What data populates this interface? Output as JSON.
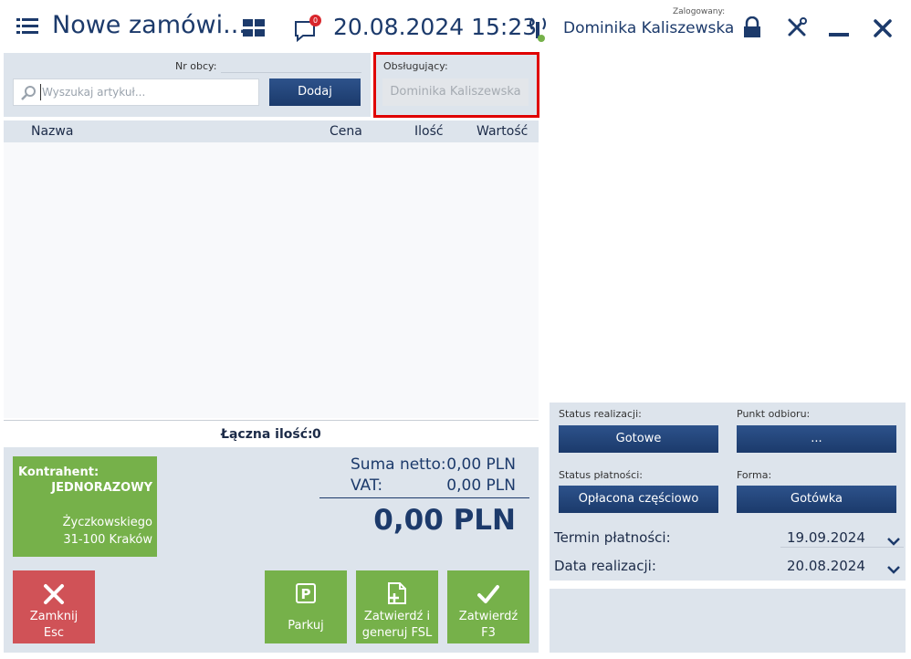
{
  "header": {
    "title": "Nowe zamówi...",
    "datetime": "20.08.2024 15:23",
    "notifications_count": "0",
    "logged_label": "Zalogowany:",
    "user": "Dominika Kaliszewska"
  },
  "top": {
    "foreign_no_label": "Nr obcy:",
    "search_placeholder": "Wyszukaj artykuł...",
    "add_label": "Dodaj",
    "handler_label": "Obsługujący:",
    "handler_value": "Dominika Kaliszewska"
  },
  "table": {
    "columns": [
      "Nazwa",
      "Cena",
      "Ilość",
      "Wartość"
    ],
    "total_qty_label": "Łączna ilość:",
    "total_qty_value": "0"
  },
  "customer": {
    "label": "Kontrahent:",
    "name": "JEDNORAZOWY",
    "street": "Życzkowskiego",
    "city": "31-100 Kraków"
  },
  "totals": {
    "net_label": "Suma netto:",
    "net_value": "0,00 PLN",
    "vat_label": "VAT:",
    "vat_value": "0,00 PLN",
    "gross": "0,00 PLN"
  },
  "actions": {
    "close_label": "Zamknij",
    "close_key": "Esc",
    "park_label": "Parkuj",
    "confirm_fsl_line1": "Zatwierdź i",
    "confirm_fsl_line2": "generuj FSL",
    "confirm_line1": "Zatwierdź",
    "confirm_key": "F3"
  },
  "order": {
    "status_label": "Status realizacji:",
    "status_value": "Gotowe",
    "pickup_label": "Punkt odbioru:",
    "pickup_value": "...",
    "payment_status_label": "Status płatności:",
    "payment_status_value": "Opłacona częściowo",
    "form_label": "Forma:",
    "form_value": "Gotówka",
    "payment_due_label": "Termin płatności:",
    "payment_due_value": "19.09.2024",
    "realization_label": "Data realizacji:",
    "realization_value": "20.08.2024"
  },
  "colors": {
    "accent": "#1b3a6b",
    "green": "#76b14a",
    "red": "#d05257",
    "panel": "#dde4ec",
    "highlight": "#e00000"
  },
  "icons": [
    "menu-icon",
    "grid-icon",
    "notification-icon",
    "signal-icon",
    "lock-icon",
    "tools-icon",
    "minimize-icon",
    "close-icon",
    "search-icon",
    "x-icon",
    "parking-icon",
    "document-add-icon",
    "check-icon",
    "chevron-down-icon"
  ]
}
